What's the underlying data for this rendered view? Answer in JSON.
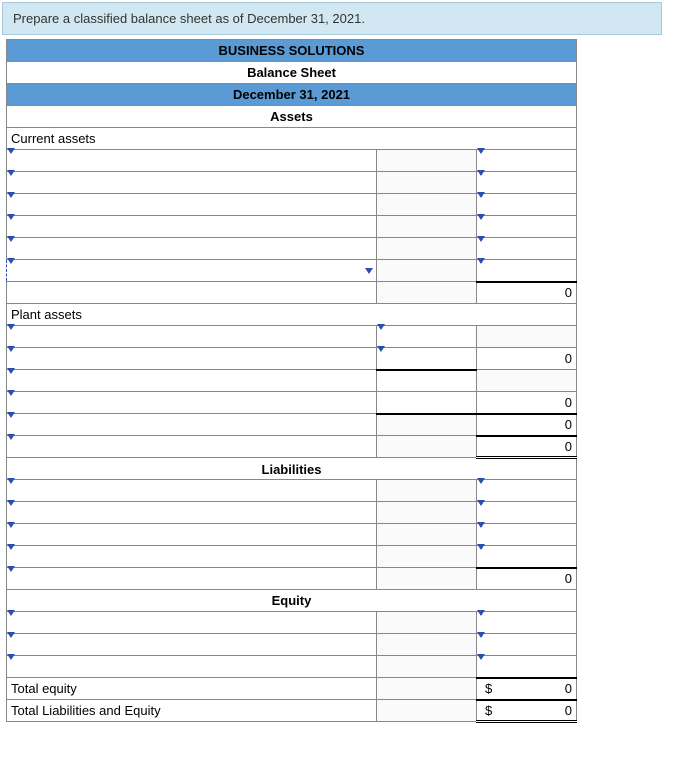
{
  "instruction": "Prepare a classified balance sheet as of December 31, 2021.",
  "header": {
    "company": "BUSINESS SOLUTIONS",
    "title": "Balance Sheet",
    "date": "December 31, 2021"
  },
  "sections": {
    "assets": "Assets",
    "current_assets": "Current assets",
    "plant_assets": "Plant assets",
    "liabilities": "Liabilities",
    "equity": "Equity",
    "total_equity": "Total equity",
    "total_liab_equity": "Total Liabilities and Equity"
  },
  "values": {
    "zero": "0",
    "currency": "$"
  }
}
